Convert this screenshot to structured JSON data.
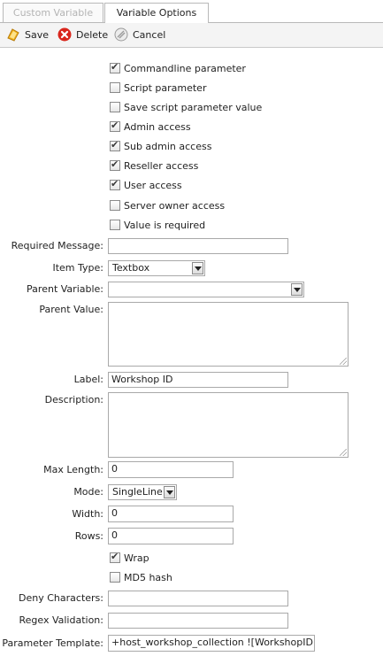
{
  "tabs": [
    {
      "label": "Custom Variable",
      "active": false
    },
    {
      "label": "Variable Options",
      "active": true
    }
  ],
  "toolbar": {
    "save": {
      "label": "Save",
      "icon": "save-icon",
      "color": "#e8a317"
    },
    "delete": {
      "label": "Delete",
      "icon": "delete-icon",
      "color": "#d9261c"
    },
    "cancel": {
      "label": "Cancel",
      "icon": "cancel-icon",
      "color": "#9a9a9a"
    }
  },
  "options": [
    {
      "label": "Commandline parameter",
      "checked": true
    },
    {
      "label": "Script parameter",
      "checked": false
    },
    {
      "label": "Save script parameter value",
      "checked": false
    },
    {
      "label": "Admin access",
      "checked": true
    },
    {
      "label": "Sub admin access",
      "checked": true
    },
    {
      "label": "Reseller access",
      "checked": true
    },
    {
      "label": "User access",
      "checked": true
    },
    {
      "label": "Server owner access",
      "checked": false
    },
    {
      "label": "Value is required",
      "checked": false
    }
  ],
  "form": {
    "required_message": {
      "label": "Required Message:",
      "value": ""
    },
    "item_type": {
      "label": "Item Type:",
      "value": "Textbox"
    },
    "parent_variable": {
      "label": "Parent Variable:",
      "value": ""
    },
    "parent_value": {
      "label": "Parent Value:",
      "value": ""
    },
    "label": {
      "label": "Label:",
      "value": "Workshop ID"
    },
    "description": {
      "label": "Description:",
      "value": ""
    },
    "max_length": {
      "label": "Max Length:",
      "value": "0"
    },
    "mode": {
      "label": "Mode:",
      "value": "SingleLine"
    },
    "width": {
      "label": "Width:",
      "value": "0"
    },
    "rows": {
      "label": "Rows:",
      "value": "0"
    },
    "wrap": {
      "label": "Wrap",
      "checked": true
    },
    "md5": {
      "label": "MD5 hash",
      "checked": false
    },
    "deny_characters": {
      "label": "Deny Characters:",
      "value": ""
    },
    "regex_validation": {
      "label": "Regex Validation:",
      "value": ""
    },
    "parameter_template": {
      "label": "Parameter Template:",
      "value": "+host_workshop_collection ![WorkshopID]"
    }
  }
}
